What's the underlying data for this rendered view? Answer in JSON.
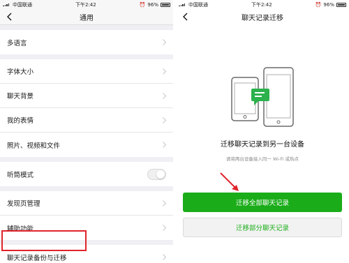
{
  "status": {
    "carrier": "中国联通",
    "time": "下午2:42",
    "battery": "96%"
  },
  "left": {
    "title": "通用",
    "rows": {
      "language": "多语言",
      "font_size": "字体大小",
      "chat_background": "聊天背景",
      "my_stickers": "我的表情",
      "media_files": "照片、视频和文件",
      "earpiece_mode": "听筒模式",
      "discover_manage": "发现页管理",
      "accessibility": "辅助功能",
      "backup_migrate": "聊天记录备份与迁移"
    },
    "earpiece_toggle_on": false
  },
  "right": {
    "title": "聊天记录迁移",
    "heading": "迁移聊天记录到另一台设备",
    "subtext": "请将两台设备接入同一 Wi-Fi 或热点",
    "btn_all": "迁移全部聊天记录",
    "btn_partial": "迁移部分聊天记录"
  },
  "colors": {
    "accent_green": "#1aad19",
    "highlight_red": "#e0242c"
  },
  "icons": [
    "back-icon",
    "chevron-right-icon",
    "phone-migration-illustration",
    "red-arrow"
  ]
}
